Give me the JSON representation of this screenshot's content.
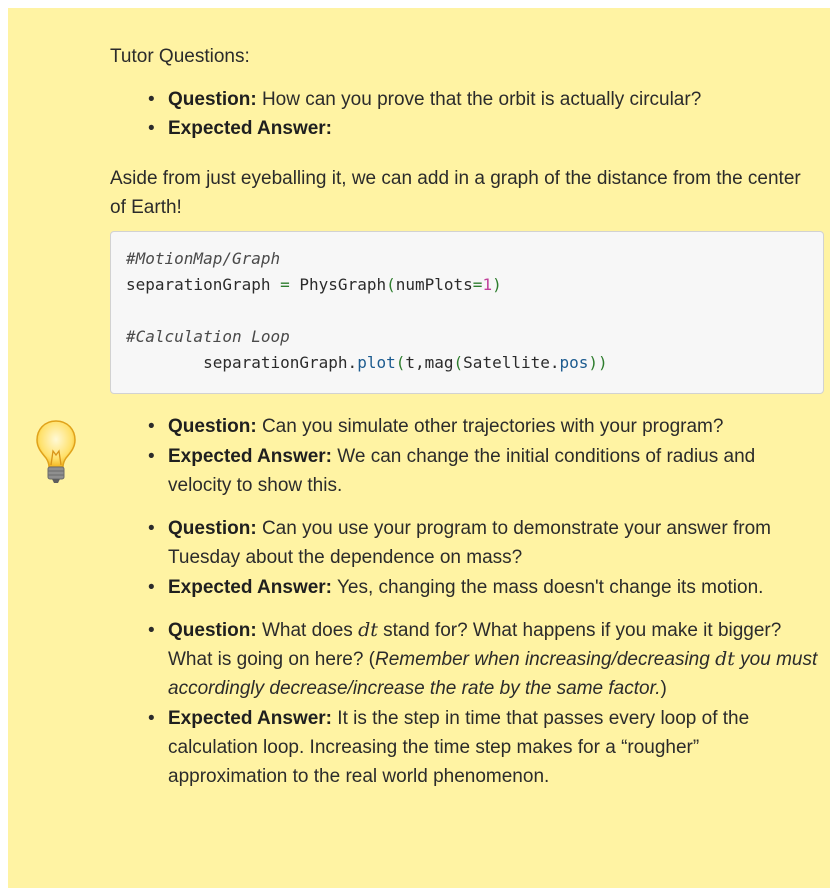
{
  "intro_label": "Tutor Questions:",
  "q1": {
    "question_label": "Question:",
    "question_text": " How can you prove that the orbit is actually circular?",
    "answer_label": "Expected Answer:"
  },
  "aside_text": "Aside from just eyeballing it, we can add in a graph of the distance from the center of Earth!",
  "code": {
    "comment1": "#MotionMap/Graph",
    "line2_var": "separationGraph ",
    "line2_eq": "=",
    "line2_func": " PhysGraph",
    "line2_lparen": "(",
    "line2_arg": "numPlots",
    "line2_argeq": "=",
    "line2_num": "1",
    "line2_rparen": ")",
    "comment2": "#Calculation Loop",
    "line5_obj": "        separationGraph.",
    "line5_method": "plot",
    "line5_lparen": "(",
    "line5_args": "t,mag",
    "line5_lparen2": "(",
    "line5_inner": "Satellite.",
    "line5_attr": "pos",
    "line5_rparen": "))"
  },
  "groups": [
    {
      "question_label": "Question:",
      "question_text": " Can you simulate other trajectories with your program?",
      "answer_label": "Expected Answer:",
      "answer_text": " We can change the initial conditions of radius and velocity to show this."
    },
    {
      "question_label": "Question:",
      "question_text": " Can you use your program to demonstrate your answer from Tuesday about the dependence on mass?",
      "answer_label": "Expected Answer:",
      "answer_text": " Yes, changing the mass doesn't change its motion."
    },
    {
      "question_label": "Question:",
      "question_text_a": " What does ",
      "math_dt": "dt",
      "question_text_b": " stand for? What happens if you make it bigger? What is going on here? (",
      "question_italic_a": "Remember when increasing/decreasing ",
      "question_italic_b": " you must accordingly decrease/increase the rate by the same factor.",
      "question_text_c": ")",
      "answer_label": "Expected Answer:",
      "answer_text": " It is the step in time that passes every loop of the calculation loop. Increasing the time step makes for a “rougher” approximation to the real world phenomenon."
    }
  ],
  "icon": "lightbulb-icon",
  "colors": {
    "panel_bg": "#fff3a3",
    "code_bg": "#f7f7f7"
  }
}
